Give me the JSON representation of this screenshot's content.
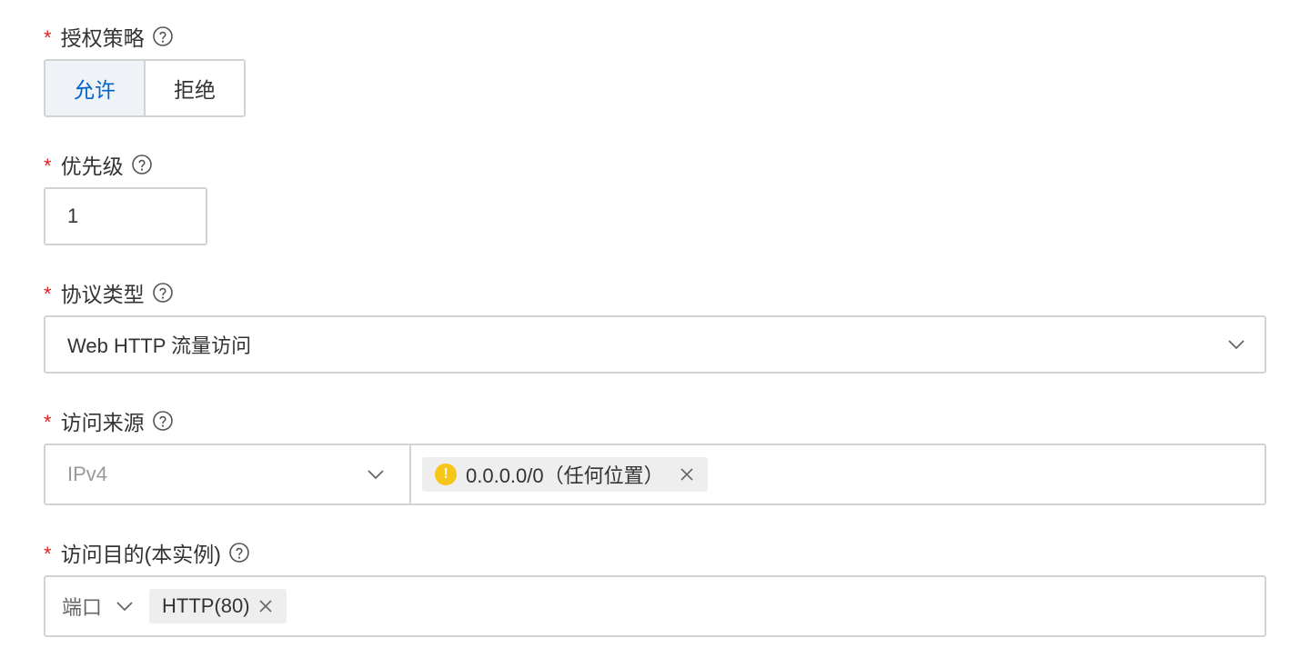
{
  "fields": {
    "policy": {
      "label": "授权策略",
      "options": [
        "允许",
        "拒绝"
      ],
      "selected": "允许"
    },
    "priority": {
      "label": "优先级",
      "value": "1"
    },
    "protocol": {
      "label": "协议类型",
      "value": "Web HTTP 流量访问"
    },
    "source": {
      "label": "访问来源",
      "type_value": "IPv4",
      "tag": "0.0.0.0/0（任何位置）"
    },
    "destination": {
      "label": "访问目的(本实例)",
      "type_value": "端口",
      "tag": "HTTP(80)"
    }
  },
  "required_mark": "*",
  "colors": {
    "accent": "#0064c8",
    "required": "#e02020",
    "warning": "#f5c518",
    "border": "#d3d3d3",
    "tag_bg": "#eeeeee",
    "active_bg": "#eff3f8"
  },
  "icons": {
    "help": "help-circle-icon",
    "dropdown": "chevron-down-icon",
    "remove": "close-icon",
    "warning": "warning-icon"
  }
}
